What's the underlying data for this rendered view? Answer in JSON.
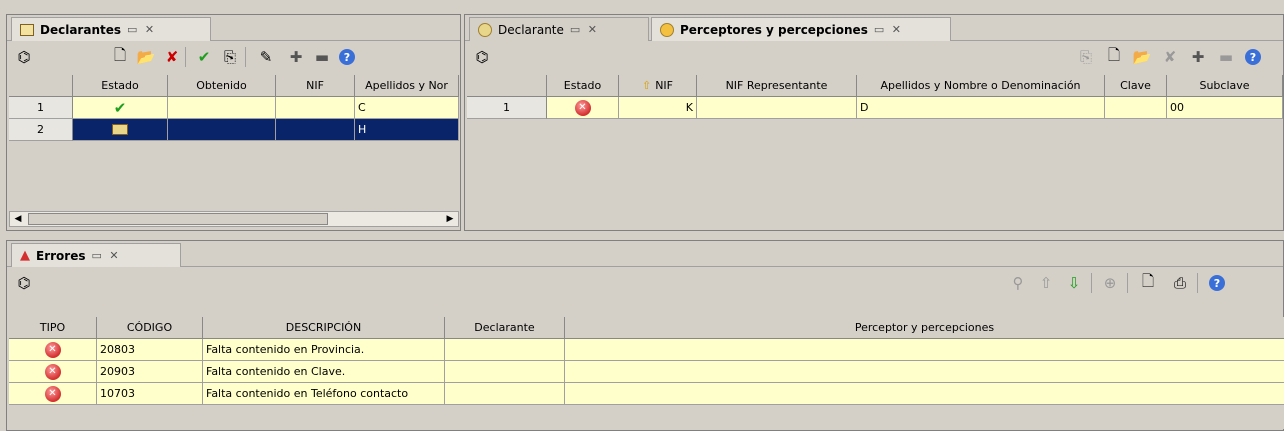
{
  "declarantes_panel": {
    "tab_label": "Declarantes",
    "columns": [
      "Estado",
      "Obtenido",
      "NIF",
      "Apellidos y Nor"
    ],
    "rows": [
      {
        "num": "1",
        "estado": "check",
        "obtenido": "",
        "nif": "",
        "apellidos": "C"
      },
      {
        "num": "2",
        "estado": "folder",
        "obtenido": "",
        "nif": "",
        "apellidos": "H"
      }
    ]
  },
  "perceptores_panel": {
    "tab_declarante": "Declarante",
    "tab_perceptores": "Perceptores y percepciones",
    "columns": [
      "Estado",
      "NIF",
      "NIF Representante",
      "Apellidos y Nombre o Denominación",
      "Clave",
      "Subclave"
    ],
    "rows": [
      {
        "num": "1",
        "estado": "error",
        "nif": "K",
        "nif_rep": "",
        "apellidos": "D",
        "clave": "",
        "subclave": "00"
      }
    ]
  },
  "errores_panel": {
    "tab_label": "Errores",
    "columns": [
      "TIPO",
      "CÓDIGO",
      "DESCRIPCIÓN",
      "Declarante",
      "Perceptor y percepciones"
    ],
    "rows": [
      {
        "tipo": "error",
        "codigo": "20803",
        "descripcion": "Falta contenido en Provincia.",
        "declarante": "",
        "perceptor": ""
      },
      {
        "tipo": "error",
        "codigo": "20903",
        "descripcion": "Falta contenido en Clave.",
        "declarante": "",
        "perceptor": ""
      },
      {
        "tipo": "error",
        "codigo": "10703",
        "descripcion": "Falta contenido en Teléfono contacto",
        "declarante": "",
        "perceptor": ""
      }
    ]
  },
  "colors": {
    "selection": "#0a246a",
    "row_yellow": "#ffffcc",
    "error_red": "#d32f2f",
    "check_green": "#1e9e1e"
  }
}
